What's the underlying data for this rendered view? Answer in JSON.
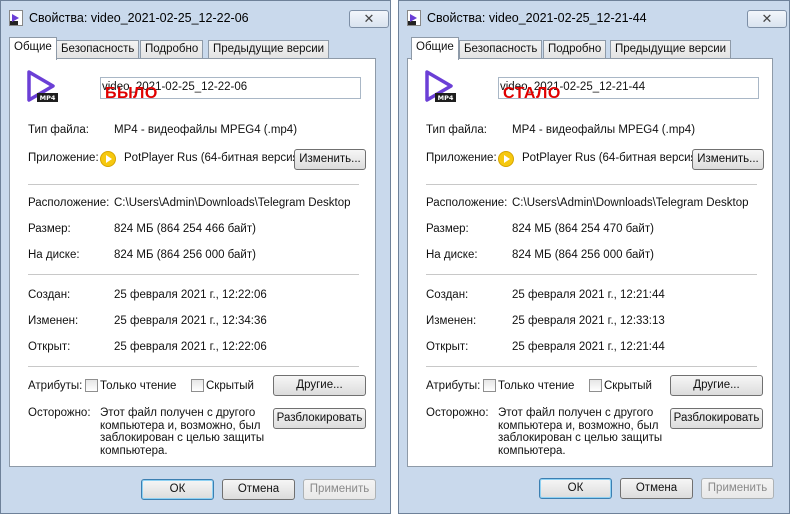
{
  "dialogs": [
    {
      "title": "Свойства: video_2021-02-25_12-22-06",
      "close_glyph": "✕",
      "tabs": [
        "Общие",
        "Безопасность",
        "Подробно",
        "Предыдущие версии"
      ],
      "filename": "video_2021-02-25_12-22-06",
      "stamp": "БЫЛО",
      "file_type_label": "Тип файла:",
      "file_type_value": "MP4 - видеофайлы MPEG4 (.mp4)",
      "app_label": "Приложение:",
      "app_value": "PotPlayer Rus (64-битная версия",
      "change_button": "Изменить...",
      "location_label": "Расположение:",
      "location_value": "C:\\Users\\Admin\\Downloads\\Telegram Desktop",
      "size_label": "Размер:",
      "size_value": "824 МБ (864 254 466 байт)",
      "disk_label": "На диске:",
      "disk_value": "824 МБ (864 256 000 байт)",
      "created_label": "Создан:",
      "created_value": "25 февраля 2021 г., 12:22:06",
      "modified_label": "Изменен:",
      "modified_value": "25 февраля 2021 г., 12:34:36",
      "opened_label": "Открыт:",
      "opened_value": "25 февраля 2021 г., 12:22:06",
      "attributes_label": "Атрибуты:",
      "readonly_label": "Только чтение",
      "hidden_label": "Скрытый",
      "other_button": "Другие...",
      "warning_label": "Осторожно:",
      "warning_text": "Этот файл получен с другого компьютера и, возможно, был заблокирован с целью защиты компьютера.",
      "unblock_button": "Разблокировать",
      "ok_button": "ОК",
      "cancel_button": "Отмена",
      "apply_button": "Применить"
    },
    {
      "title": "Свойства: video_2021-02-25_12-21-44",
      "close_glyph": "✕",
      "tabs": [
        "Общие",
        "Безопасность",
        "Подробно",
        "Предыдущие версии"
      ],
      "filename": "video_2021-02-25_12-21-44",
      "stamp": "СТАЛО",
      "file_type_label": "Тип файла:",
      "file_type_value": "MP4 - видеофайлы MPEG4 (.mp4)",
      "app_label": "Приложение:",
      "app_value": "PotPlayer Rus (64-битная версия",
      "change_button": "Изменить...",
      "location_label": "Расположение:",
      "location_value": "C:\\Users\\Admin\\Downloads\\Telegram Desktop",
      "size_label": "Размер:",
      "size_value": "824 МБ (864 254 470 байт)",
      "disk_label": "На диске:",
      "disk_value": "824 МБ (864 256 000 байт)",
      "created_label": "Создан:",
      "created_value": "25 февраля 2021 г., 12:21:44",
      "modified_label": "Изменен:",
      "modified_value": "25 февраля 2021 г., 12:33:13",
      "opened_label": "Открыт:",
      "opened_value": "25 февраля 2021 г., 12:21:44",
      "attributes_label": "Атрибуты:",
      "readonly_label": "Только чтение",
      "hidden_label": "Скрытый",
      "other_button": "Другие...",
      "warning_label": "Осторожно:",
      "warning_text": "Этот файл получен с другого компьютера и, возможно, был заблокирован с целью защиты компьютера.",
      "unblock_button": "Разблокировать",
      "ok_button": "ОК",
      "cancel_button": "Отмена",
      "apply_button": "Применить"
    }
  ],
  "icons": {
    "file_icon": "mp4-video-file-icon",
    "file_icon_badge": "MP4",
    "app_icon": "potplayer-icon",
    "title_icon": "video-file-icon",
    "close": "close-icon"
  },
  "colors": {
    "stamp": "#e00000",
    "mp4_icon": "#6b3fd6",
    "potplayer": "#f6c80f",
    "window_frame": "#c9d9ec"
  }
}
